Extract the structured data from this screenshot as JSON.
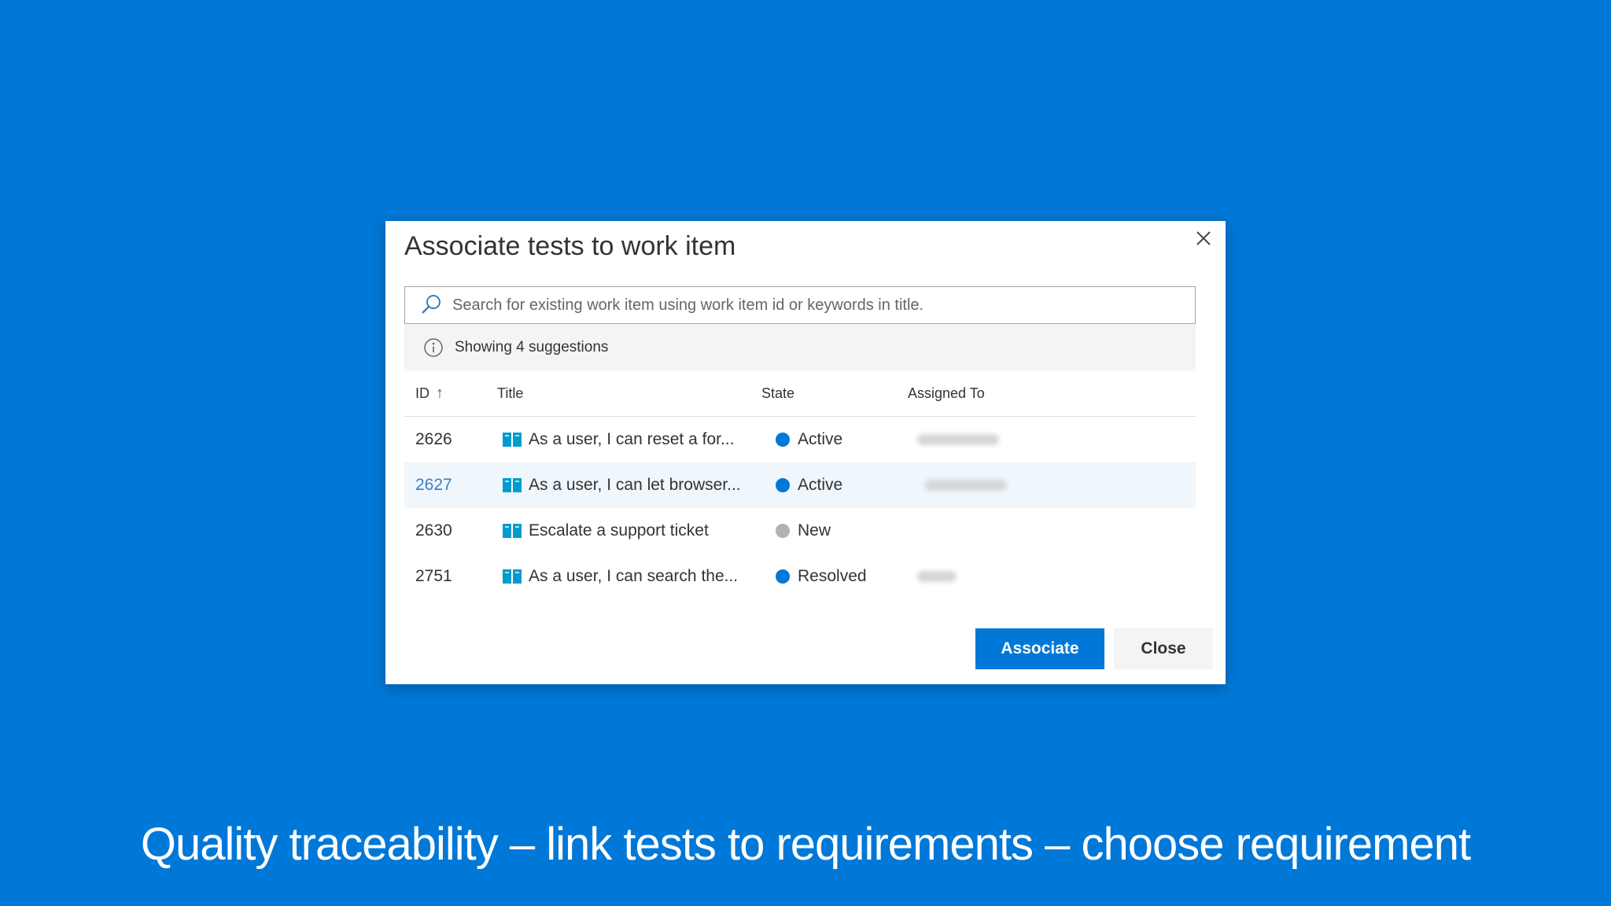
{
  "dialog": {
    "title": "Associate tests to work item",
    "close_icon": "close-icon",
    "search": {
      "placeholder": "Search for existing work item using work item id or keywords in title.",
      "value": "",
      "icon": "search-icon"
    },
    "info": {
      "icon": "info-icon",
      "text": "Showing 4 suggestions"
    },
    "table": {
      "columns": [
        "ID",
        "Title",
        "State",
        "Assigned To"
      ],
      "sort_indicator": "↑",
      "rows": [
        {
          "id": "2626",
          "title": "As a user, I can reset a for...",
          "state": "Active",
          "state_color": "#0078d7",
          "assigned": "redacted",
          "selected": false
        },
        {
          "id": "2627",
          "title": "As a user, I can let browser...",
          "state": "Active",
          "state_color": "#0078d7",
          "assigned": "redacted",
          "selected": true
        },
        {
          "id": "2630",
          "title": "Escalate a support ticket",
          "state": "New",
          "state_color": "#b2b2b2",
          "assigned": "",
          "selected": false
        },
        {
          "id": "2751",
          "title": "As a user, I can search the...",
          "state": "Resolved",
          "state_color": "#0078d7",
          "assigned": "redacted",
          "selected": false
        }
      ],
      "row_icon": "book-icon"
    },
    "buttons": {
      "associate": "Associate",
      "close": "Close"
    }
  },
  "caption": "Quality traceability – link tests to requirements – choose requirement",
  "colors": {
    "background": "#0078d7",
    "primary": "#0078d7",
    "selected_row": "#eff6fc"
  }
}
